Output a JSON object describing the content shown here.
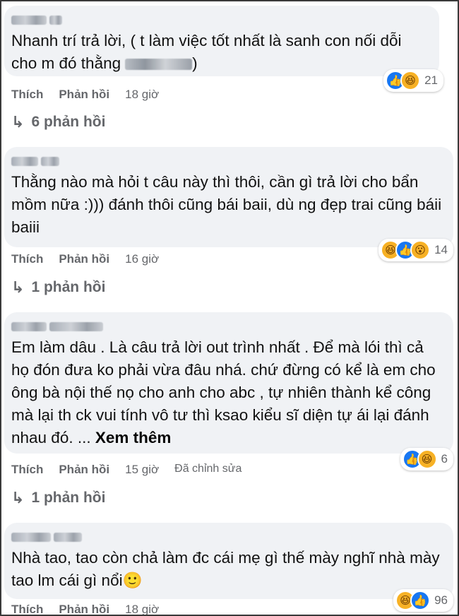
{
  "comments": [
    {
      "text": "Nhanh trí trả lời, ( t làm việc tốt nhất là sanh con nối dỗi cho m đó thằng",
      "text_tail": ")",
      "reactions": {
        "icons": [
          "like-icon",
          "haha-icon"
        ],
        "count": "21"
      },
      "actions": {
        "like": "Thích",
        "reply": "Phản hồi",
        "time": "18 giờ"
      },
      "replies": "6 phản hồi"
    },
    {
      "text": "Thằng nào mà hỏi t câu này thì thôi, cần gì trả lời cho bẩn mồm nữa :))) đánh thôi cũng bái baii, dù ng đẹp trai cũng báii baiii",
      "reactions": {
        "icons": [
          "haha-icon",
          "like-icon",
          "wow-icon"
        ],
        "count": "14"
      },
      "actions": {
        "like": "Thích",
        "reply": "Phản hồi",
        "time": "16 giờ"
      },
      "replies": "1 phản hồi"
    },
    {
      "text": "Em làm dâu . Là câu trả lời out trình nhất . Để mà lói thì cả họ đón đưa ko phải vừa đâu nhá. chứ đừng có kể là em cho ông bà nội thế nọ cho anh cho abc , tự nhiên thành kể công mà lại th ck vui tính vô tư thì ksao kiểu sĩ diện tự ái lại đánh nhau đó. ...",
      "see_more": "Xem thêm",
      "reactions": {
        "icons": [
          "like-icon",
          "haha-icon"
        ],
        "count": "6"
      },
      "actions": {
        "like": "Thích",
        "reply": "Phản hồi",
        "time": "15 giờ",
        "edited": "Đã chỉnh sửa"
      },
      "replies": "1 phản hồi"
    },
    {
      "text": "Nhà tao, tao còn chả làm đc cái mẹ gì thế mày nghĩ nhà mày tao lm cái gì nổi🙂",
      "reactions": {
        "icons": [
          "haha-icon",
          "like-icon"
        ],
        "count": "96"
      },
      "actions": {
        "like": "Thích",
        "reply": "Phản hồi",
        "time": "18 giờ"
      }
    }
  ]
}
